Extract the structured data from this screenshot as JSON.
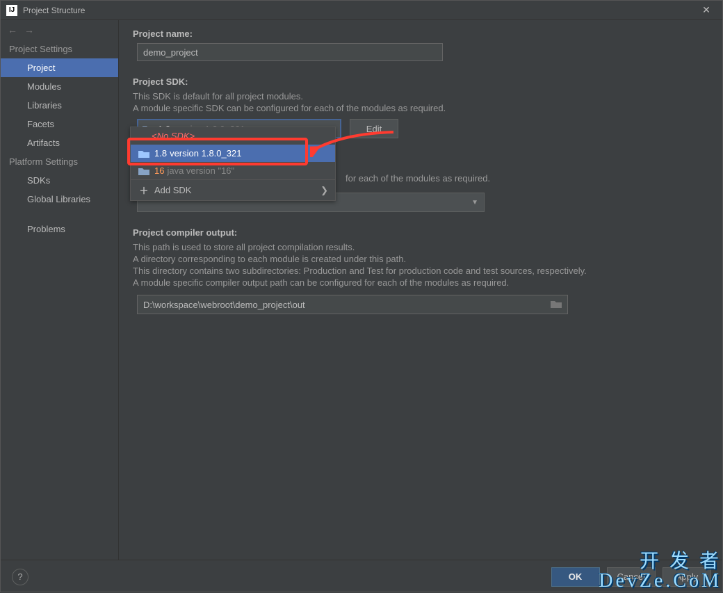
{
  "window": {
    "title": "Project Structure",
    "logo": "IJ",
    "close": "✕"
  },
  "nav": {
    "back": "←",
    "forward": "→",
    "sections": [
      {
        "title": "Project Settings",
        "items": [
          "Project",
          "Modules",
          "Libraries",
          "Facets",
          "Artifacts"
        ],
        "selected": "Project"
      },
      {
        "title": "Platform Settings",
        "items": [
          "SDKs",
          "Global Libraries"
        ]
      },
      {
        "title": "",
        "items": [
          "Problems"
        ]
      }
    ]
  },
  "content": {
    "projectName": {
      "label": "Project name:",
      "value": "demo_project"
    },
    "sdk": {
      "label": "Project SDK:",
      "desc1": "This SDK is default for all project modules.",
      "desc2": "A module specific SDK can be configured for each of the modules as required.",
      "combo": {
        "main": "1.8",
        "sub": "version 1.8.0_321"
      },
      "editBtn": "Edit",
      "dropdown": {
        "none": "<No SDK>",
        "items": [
          {
            "main": "1.8",
            "sub": "version 1.8.0_321",
            "selected": true,
            "color": "#9ec7ff"
          },
          {
            "main": "16",
            "sub": "java version \"16\"",
            "color": "#ff9a59"
          }
        ],
        "add": "Add SDK"
      }
    },
    "langLevel": {
      "hiddenDesc": "for each of the modules as required."
    },
    "compilerOut": {
      "label": "Project compiler output:",
      "d1": "This path is used to store all project compilation results.",
      "d2": "A directory corresponding to each module is created under this path.",
      "d3": "This directory contains two subdirectories: Production and Test for production code and test sources, respectively.",
      "d4": "A module specific compiler output path can be configured for each of the modules as required.",
      "path": "D:\\workspace\\webroot\\demo_project\\out"
    }
  },
  "buttons": {
    "ok": "OK",
    "cancel": "Cancel",
    "apply": "Apply",
    "help": "?"
  },
  "watermark": {
    "l1": "开 发 者",
    "l2": "DevZe.CoM"
  }
}
